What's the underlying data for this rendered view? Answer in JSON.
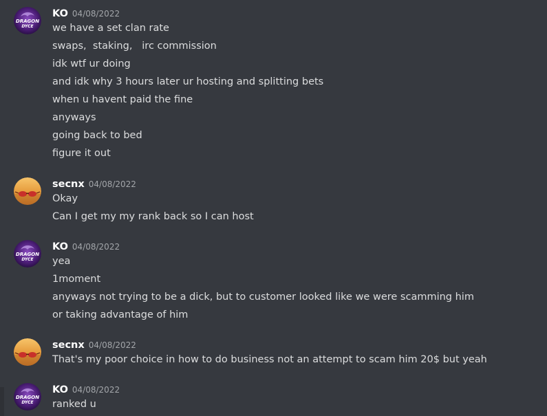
{
  "messages": [
    {
      "author": "KO",
      "avatar": "dragon-dyce-avatar",
      "timestamp": "04/08/2022",
      "lines": [
        "we have a set clan rate",
        "swaps,  staking,   irc commission",
        "idk wtf ur doing",
        "and idk why 3 hours later ur hosting and splitting bets",
        "when u havent paid the fine",
        "anyways",
        "going back to bed",
        "figure it out"
      ]
    },
    {
      "author": "secnx",
      "avatar": "sunglasses-sunset-avatar",
      "timestamp": "04/08/2022",
      "lines": [
        "Okay",
        "Can I get my my rank back so I can host"
      ]
    },
    {
      "author": "KO",
      "avatar": "dragon-dyce-avatar",
      "timestamp": "04/08/2022",
      "lines": [
        "yea",
        "1moment",
        "anyways not trying to be a dick, but to customer looked like we were scamming him",
        "or taking advantage of him"
      ]
    },
    {
      "author": "secnx",
      "avatar": "sunglasses-sunset-avatar",
      "timestamp": "04/08/2022",
      "lines": [
        "That's my poor choice in how to do business not an attempt to scam him 20$ but yeah"
      ]
    },
    {
      "author": "KO",
      "avatar": "dragon-dyce-avatar",
      "timestamp": "04/08/2022",
      "lines": [
        "ranked u"
      ]
    }
  ],
  "avatars": {
    "dragon-dyce-avatar": {
      "text_top": "DRAGON",
      "text_bottom": "DYCE",
      "color": "#5b2a86"
    },
    "sunglasses-sunset-avatar": {
      "color": "#e0a040"
    }
  },
  "colors": {
    "background": "#36393f",
    "text": "#dcddde",
    "username": "#ffffff",
    "timestamp": "#a3a6aa"
  }
}
